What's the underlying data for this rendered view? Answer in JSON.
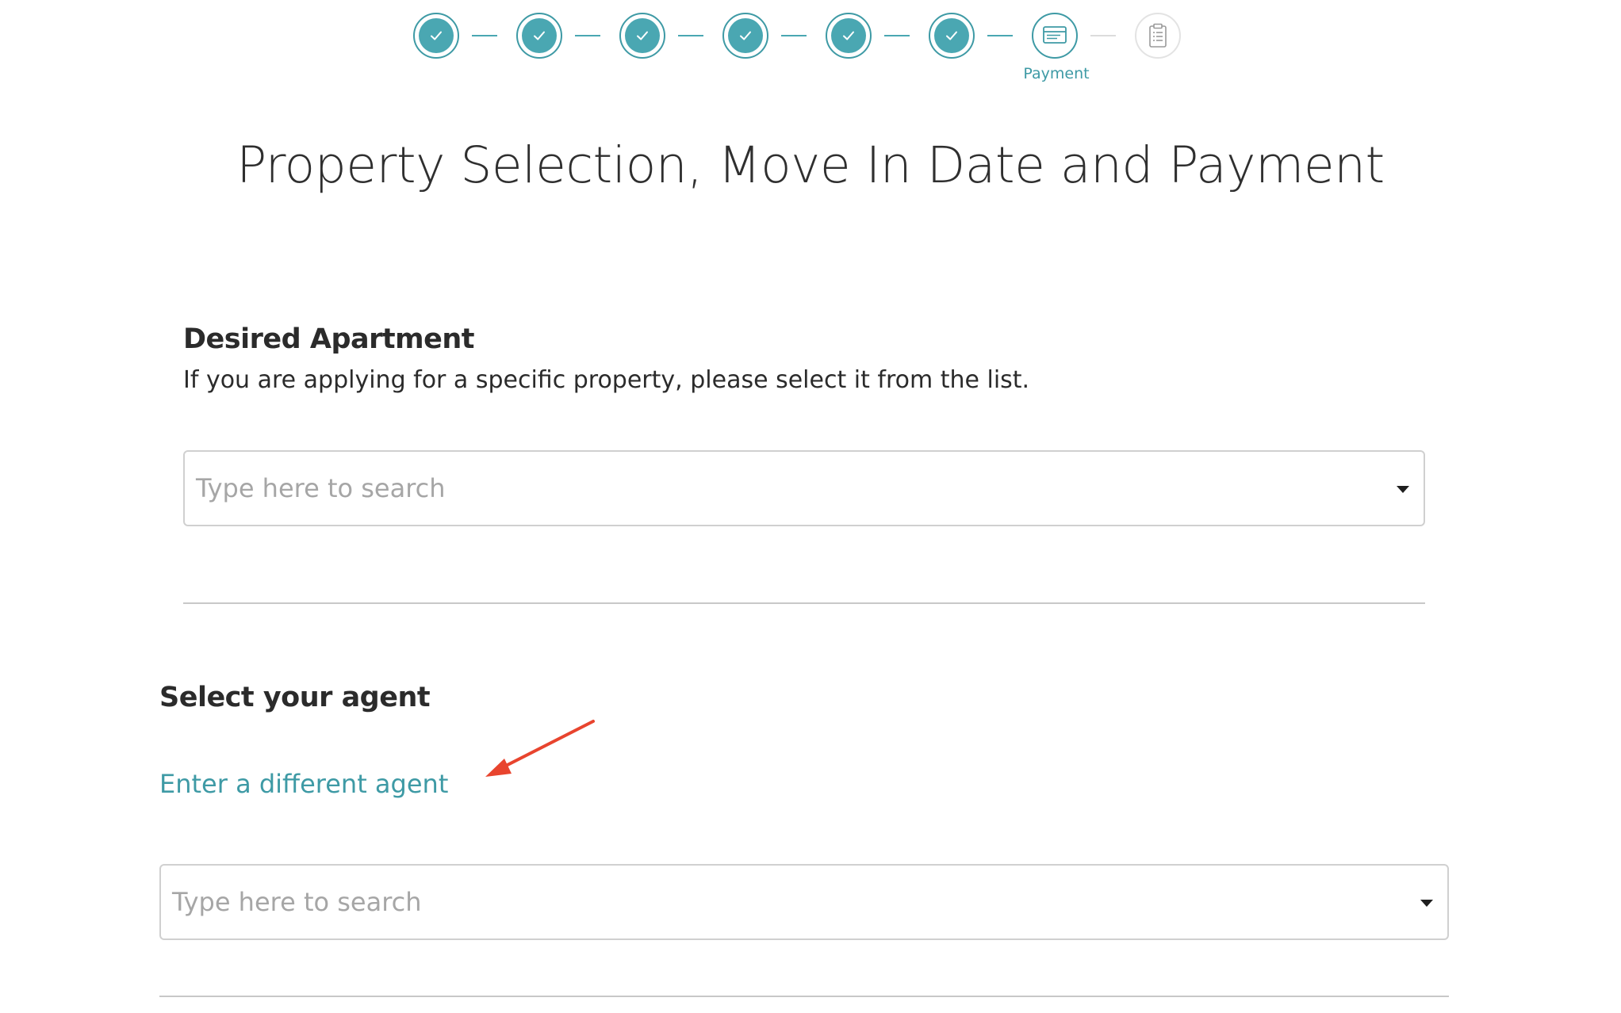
{
  "stepper": {
    "steps": [
      {
        "status": "completed",
        "icon": "check-icon"
      },
      {
        "status": "completed",
        "icon": "check-icon"
      },
      {
        "status": "completed",
        "icon": "check-icon"
      },
      {
        "status": "completed",
        "icon": "check-icon"
      },
      {
        "status": "completed",
        "icon": "check-icon"
      },
      {
        "status": "completed",
        "icon": "check-icon"
      },
      {
        "status": "current",
        "icon": "credit-card-icon",
        "label": "Payment"
      },
      {
        "status": "upcoming",
        "icon": "clipboard-icon"
      }
    ],
    "current_label": "Payment"
  },
  "page_title": "Property Selection, Move In Date and Payment",
  "desired_apartment": {
    "heading": "Desired Apartment",
    "description": "If you are applying for a specific property, please select it from the list.",
    "search": {
      "placeholder": "Type here to search",
      "value": ""
    }
  },
  "agent": {
    "heading": "Select your agent",
    "link_label": "Enter a different agent",
    "search": {
      "placeholder": "Type here to search",
      "value": ""
    }
  },
  "colors": {
    "accent": "#4aa7b2",
    "annotation": "#e8442e",
    "divider": "#c8c8c8"
  }
}
